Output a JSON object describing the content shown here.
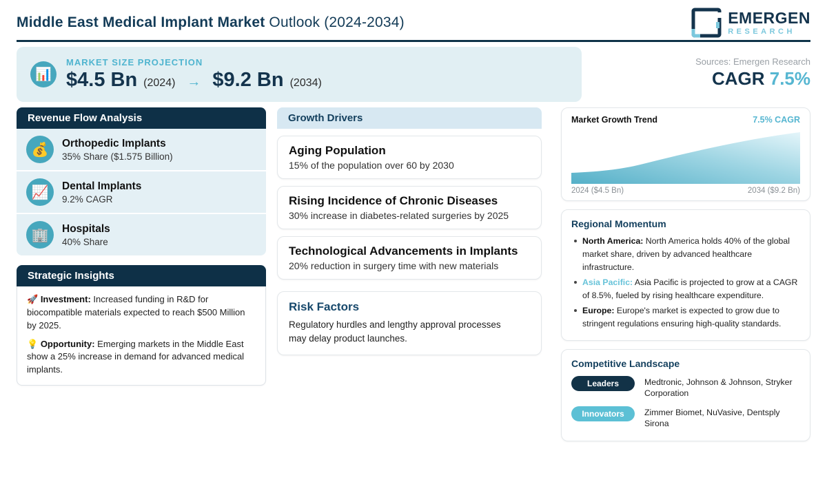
{
  "header": {
    "title_bold": "Middle East Medical Implant Market",
    "title_rest": " Outlook (2024-2034)",
    "logo": {
      "line1": "EMERGEN",
      "line2": "RESEARCH"
    }
  },
  "banner": {
    "icon": "📊",
    "label": "MARKET SIZE PROJECTION",
    "start_value": "$4.5 Bn",
    "start_year": "(2024)",
    "arrow": "→",
    "end_value": "$9.2 Bn",
    "end_year": "(2034)"
  },
  "meta": {
    "sources": "Sources: Emergen Research",
    "cagr_label": "CAGR",
    "cagr_value": "7.5%"
  },
  "revenue_flow": {
    "title": "Revenue Flow Analysis",
    "items": [
      {
        "icon": "💰",
        "title": "Orthopedic Implants",
        "subtitle": "35% Share ($1.575 Billion)"
      },
      {
        "icon": "📈",
        "title": "Dental Implants",
        "subtitle": "9.2% CAGR"
      },
      {
        "icon": "🏢",
        "title": "Hospitals",
        "subtitle": "40% Share"
      }
    ]
  },
  "strategic_insights": {
    "title": "Strategic Insights",
    "items": [
      {
        "icon": "🚀",
        "lead": "Investment:",
        "text": " Increased funding in R&D for biocompatible materials expected to reach $500 Million by 2025."
      },
      {
        "icon": "💡",
        "lead": "Opportunity:",
        "text": " Emerging markets in the Middle East show a 25% increase in demand for advanced medical implants."
      }
    ]
  },
  "growth_drivers": {
    "title": "Growth Drivers",
    "items": [
      {
        "title": "Aging Population",
        "subtitle": "15% of the population over 60 by 2030"
      },
      {
        "title": "Rising Incidence of Chronic Diseases",
        "subtitle": "30% increase in diabetes-related surgeries by 2025"
      },
      {
        "title": "Technological Advancements in Implants",
        "subtitle": "20% reduction in surgery time with new materials"
      }
    ]
  },
  "risk_factors": {
    "title": "Risk Factors",
    "text": "Regulatory hurdles and lengthy approval processes may delay product launches."
  },
  "market_growth_trend": {
    "title": "Market Growth Trend",
    "cagr": "7.5% CAGR",
    "start_label": "2024 ($4.5 Bn)",
    "end_label": "2034 ($9.2 Bn)"
  },
  "regional_momentum": {
    "title": "Regional Momentum",
    "items": [
      {
        "lead": "North America:",
        "text": " North America holds 40% of the global market share, driven by advanced healthcare infrastructure."
      },
      {
        "lead": "Asia Pacific:",
        "text": " Asia Pacific is projected to grow at a CAGR of 8.5%, fueled by rising healthcare expenditure."
      },
      {
        "lead": "Europe:",
        "text": " Europe's market is expected to grow due to stringent regulations ensuring high-quality standards."
      }
    ]
  },
  "competitive_landscape": {
    "title": "Competitive Landscape",
    "groups": [
      {
        "badge": "Leaders",
        "companies": "Medtronic, Johnson & Johnson, Stryker Corporation"
      },
      {
        "badge": "Innovators",
        "companies": "Zimmer Biomet, NuVasive, Dentsply Sirona"
      }
    ]
  },
  "chart_data": {
    "type": "area",
    "title": "Market Growth Trend",
    "x": [
      2024,
      2034
    ],
    "values": [
      4.5,
      9.2
    ],
    "x_labels": [
      "2024 ($4.5 Bn)",
      "2034 ($9.2 Bn)"
    ],
    "annotation": "7.5% CAGR",
    "unit": "USD Billion",
    "grid": false,
    "legend": false
  },
  "colors": {
    "navy": "#0e3047",
    "title_navy": "#133b57",
    "teal_accent": "#4fb4cf",
    "cagr_teal": "#56b6d1",
    "banner_bg": "#e1eff3",
    "item_bg": "#e4f0f5",
    "drivers_header_bg": "#d7e8f2",
    "icon_circle": "#46a7bd",
    "innovators_pill": "#5cc0d5",
    "asia_pacific_lead": "#67c3d9"
  }
}
